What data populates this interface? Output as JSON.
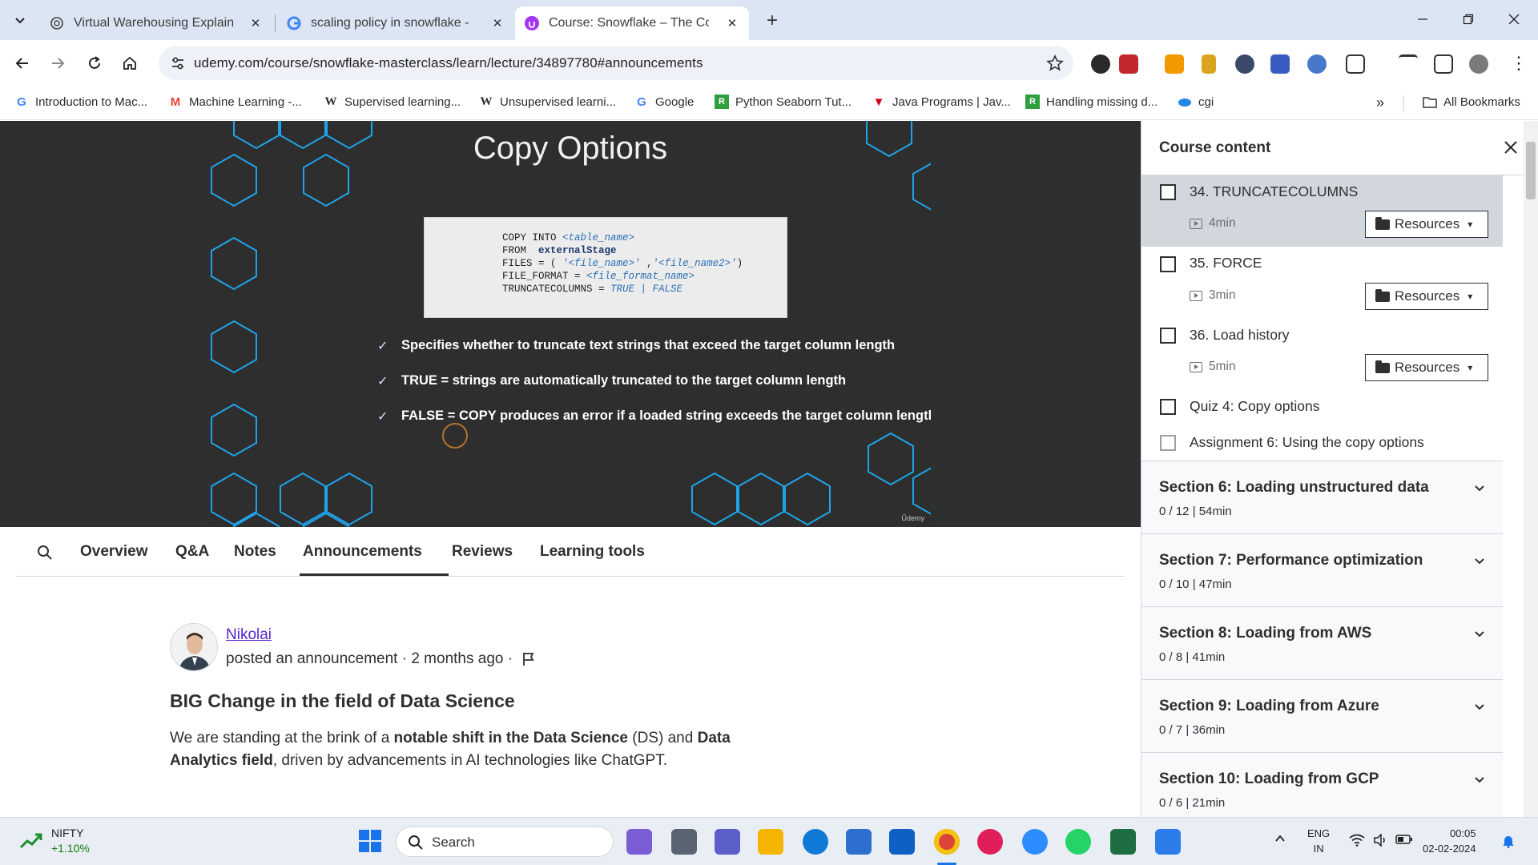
{
  "browser": {
    "tabs": [
      {
        "title": "Virtual Warehousing Explained",
        "icon": "openai-icon"
      },
      {
        "title": "scaling policy in snowflake - Go",
        "icon": "google-icon"
      },
      {
        "title": "Course: Snowflake – The Compl",
        "icon": "udemy-icon"
      }
    ],
    "url": "udemy.com/course/snowflake-masterclass/learn/lecture/34897780#announcements",
    "bookmarks": [
      {
        "label": "Introduction to Mac...",
        "icon": "google-icon"
      },
      {
        "label": "Machine Learning -...",
        "icon": "gmail-icon"
      },
      {
        "label": "Supervised learning...",
        "icon": "wikipedia-icon"
      },
      {
        "label": "Unsupervised learni...",
        "icon": "wikipedia-icon"
      },
      {
        "label": "Google",
        "icon": "google-icon"
      },
      {
        "label": "Python Seaborn Tut...",
        "icon": "pythonclass-icon"
      },
      {
        "label": "Java Programs | Jav...",
        "icon": "java-icon"
      },
      {
        "label": "Handling missing d...",
        "icon": "pythonclass-icon"
      },
      {
        "label": "cgi",
        "icon": "cloud-icon"
      }
    ],
    "all_bookmarks": "All Bookmarks"
  },
  "slide": {
    "title": "Copy Options",
    "code": {
      "l1a": "COPY INTO ",
      "l1b": "<table_name>",
      "l2a": "FROM  ",
      "l2b": "externalStage",
      "l3a": "FILES = ( ",
      "l3b": "'<file_name>'",
      "l3c": " ,",
      "l3d": "'<file_name2>'",
      "l3e": ")",
      "l4a": "FILE_FORMAT = ",
      "l4b": "<file_format_name>",
      "l5a": "TRUNCATECOLUMNS = ",
      "l5b": "TRUE | FALSE"
    },
    "bullets": [
      "Specifies whether to truncate text strings that exceed the target column length",
      "TRUE = strings are automatically truncated to the target column length",
      "FALSE = COPY produces an error if a loaded string exceeds the target column length"
    ],
    "watermark": "Ûdemy"
  },
  "page_tabs": [
    "Overview",
    "Q&A",
    "Notes",
    "Announcements",
    "Reviews",
    "Learning tools"
  ],
  "active_tab": "Announcements",
  "announcement": {
    "author": "Nikolai",
    "posted": "posted an announcement · 2 months ago ·",
    "title": "BIG Change in the field of Data Science",
    "body_1": "We are standing at the brink of a ",
    "body_2": "notable shift in the Data Science",
    "body_3": " (DS) and ",
    "body_4": "Data Analytics field",
    "body_5": ", driven by advancements in AI technologies like ChatGPT."
  },
  "sidebar": {
    "title": "Course content",
    "lectures": [
      {
        "title": "34. TRUNCATECOLUMNS",
        "duration": "4min",
        "resources": "Resources"
      },
      {
        "title": "35. FORCE",
        "duration": "3min",
        "resources": "Resources"
      },
      {
        "title": "36. Load history",
        "duration": "5min",
        "resources": "Resources"
      }
    ],
    "quiz": "Quiz 4: Copy options",
    "assignment": "Assignment 6: Using the copy options",
    "sections": [
      {
        "title": "Section 6: Loading unstructured data",
        "meta": "0 / 12 | 54min"
      },
      {
        "title": "Section 7: Performance optimization",
        "meta": "0 / 10 | 47min"
      },
      {
        "title": "Section 8: Loading from AWS",
        "meta": "0 / 8 | 41min"
      },
      {
        "title": "Section 9: Loading from Azure",
        "meta": "0 / 7 | 36min"
      },
      {
        "title": "Section 10: Loading from GCP",
        "meta": "0 / 6 | 21min"
      }
    ]
  },
  "taskbar": {
    "ticker": "NIFTY",
    "change": "+1.10%",
    "search": "Search",
    "lang1": "ENG",
    "lang2": "IN",
    "time": "00:05",
    "date": "02-02-2024"
  }
}
